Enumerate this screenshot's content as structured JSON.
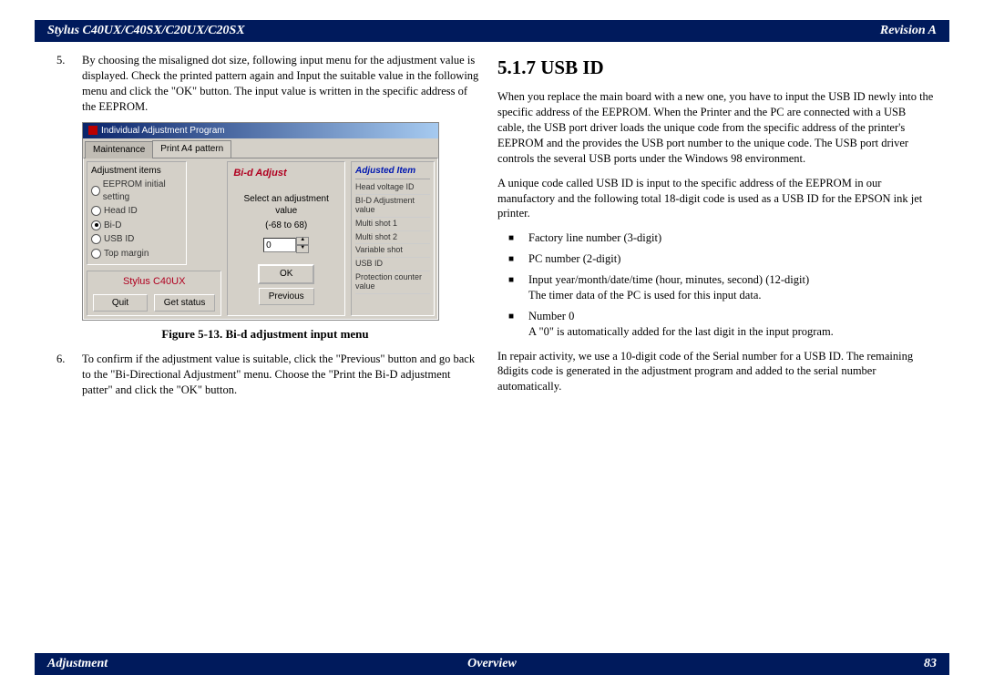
{
  "header": {
    "left": "Stylus C40UX/C40SX/C20UX/C20SX",
    "right": "Revision A"
  },
  "footer": {
    "left": "Adjustment",
    "mid": "Overview",
    "right": "83"
  },
  "left_col": {
    "item5_num": "5.",
    "item5": "By choosing the misaligned dot size, following input menu for the adjustment value is displayed. Check the printed pattern again and Input the suitable value in the following menu and click the \"OK\" button. The input value is written in the specific address of the EEPROM.",
    "fig_caption": "Figure 5-13.  Bi-d adjustment input menu",
    "item6_num": "6.",
    "item6": "To confirm if the adjustment value is suitable, click the \"Previous\" button and go back to the \"Bi-Directional Adjustment\" menu. Choose the \"Print the Bi-D adjustment patter\" and click the \"OK\" button."
  },
  "shot": {
    "title": "Individual Adjustment Program",
    "tab1": "Maintenance",
    "tab2": "Print A4 pattern",
    "left_group": "Adjustment items",
    "r1": "EEPROM initial setting",
    "r2": "Head ID",
    "r3": "Bi-D",
    "r4": "USB ID",
    "r5": "Top margin",
    "mid_title": "Bi-d Adjust",
    "mid_line1": "Select an adjustment value",
    "mid_line2": "(-68 to 68)",
    "spin_val": "0",
    "ok": "OK",
    "prev": "Previous",
    "model": "Stylus C40UX",
    "quit": "Quit",
    "status": "Get status",
    "right_title": "Adjusted Item",
    "ri1": "Head voltage ID",
    "ri2": "BI-D Adjustment value",
    "ri3": "Multi shot 1",
    "ri4": "Multi shot 2",
    "ri5": "Variable shot",
    "ri6": "USB ID",
    "ri7": "Protection counter value"
  },
  "right_col": {
    "heading": "5.1.7  USB ID",
    "p1": "When you replace the main board with a new one, you have to input the USB ID newly into the specific address of the EEPROM. When the Printer and the PC are connected with a USB cable, the USB port driver loads the unique code from the specific address of the printer's EEPROM and the provides the USB port number to the unique code. The USB port driver controls the several USB ports under the Windows 98 environment.",
    "p2": "A unique code called USB ID is input to the specific address of the EEPROM in our manufactory and the following total 18-digit code is used as a USB ID for the EPSON ink jet printer.",
    "li1": "Factory line number (3-digit)",
    "li2": "PC number (2-digit)",
    "li3": "Input year/month/date/time (hour, minutes, second) (12-digit)",
    "li3b": "The timer data of the PC is used for this input data.",
    "li4": "Number 0",
    "li4b": "A \"0\" is automatically added for the last digit in the input program.",
    "p3": "In repair activity, we use a 10-digit code of the Serial number for a USB ID. The remaining 8digits code is generated in the adjustment program and added to the serial number automatically."
  }
}
